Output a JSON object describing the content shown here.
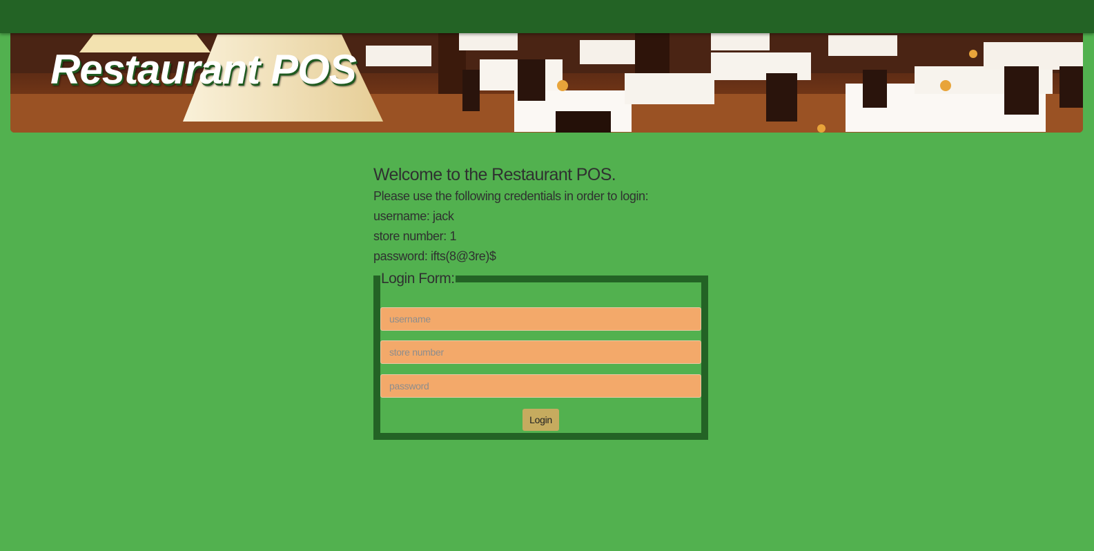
{
  "header": {
    "title": "Restaurant POS"
  },
  "intro": {
    "welcome": "Welcome to the Restaurant POS.",
    "instructions": "Please use the following credentials in order to login:",
    "username_line": "username: jack",
    "store_line": "store number: 1",
    "password_line": "password: ifts(8@3re)$"
  },
  "login_form": {
    "legend": "Login Form:",
    "username_placeholder": "username",
    "store_placeholder": "store number",
    "password_placeholder": "password",
    "submit_label": "Login"
  },
  "colors": {
    "page_background": "#52b14f",
    "topbar": "#236325",
    "field_background": "#f3a96a",
    "button_background": "#c6ab5f"
  }
}
